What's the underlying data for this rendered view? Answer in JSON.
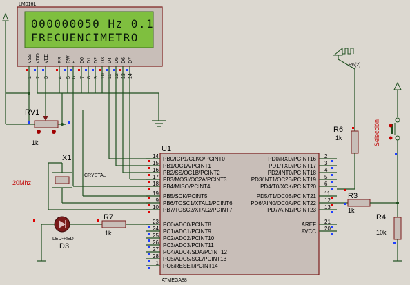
{
  "lcd": {
    "ref": "LM016L",
    "line1": "000000050 Hz 0.1",
    "line2": "FRECUENCIMETRO",
    "pins": [
      "VSS",
      "VDD",
      "VEE",
      "RS",
      "RW",
      "E",
      "D0",
      "D1",
      "D2",
      "D3",
      "D4",
      "D5",
      "D6",
      "D7"
    ],
    "pin_numbers": [
      "1",
      "2",
      "3",
      "4",
      "5",
      "6",
      "7",
      "8",
      "9",
      "10",
      "11",
      "12",
      "13",
      "14"
    ]
  },
  "rv1": {
    "ref": "RV1",
    "value": "1k"
  },
  "crystal": {
    "ref": "X1",
    "label": "CRYSTAL",
    "freq": "20Mhz"
  },
  "led": {
    "part": "LED-RED",
    "ref": "D3"
  },
  "r7": {
    "ref": "R7",
    "value": "1k"
  },
  "r6": {
    "ref": "R6",
    "value": "1k"
  },
  "r3": {
    "ref": "R3",
    "value": "1k"
  },
  "r4": {
    "ref": "R4",
    "value": "10k"
  },
  "u1": {
    "ref": "U1",
    "part": "ATMEGA88",
    "left_pins": [
      {
        "num": "14",
        "name": "PB0/ICP1/CLKO/PCINT0"
      },
      {
        "num": "15",
        "name": "PB1/OC1A/PCINT1"
      },
      {
        "num": "16",
        "name": "PB2/SS/OC1B/PCINT2"
      },
      {
        "num": "17",
        "name": "PB3/MOSI/OC2A/PCINT3"
      },
      {
        "num": "18",
        "name": "PB4/MISO/PCINT4"
      },
      {
        "num": "19",
        "name": "PB5/SCK/PCINT5"
      },
      {
        "num": "9",
        "name": "PB6/TOSC1/XTAL1/PCINT6"
      },
      {
        "num": "10",
        "name": "PB7/TOSC2/XTAL2/PCINT7"
      },
      {
        "num": "23",
        "name": "PC0/ADC0/PCINT8"
      },
      {
        "num": "24",
        "name": "PC1/ADC1/PCINT9"
      },
      {
        "num": "25",
        "name": "PC2/ADC2/PCINT10"
      },
      {
        "num": "26",
        "name": "PC3/ADC3/PCINT11"
      },
      {
        "num": "27",
        "name": "PC4/ADC4/SDA/PCINT12"
      },
      {
        "num": "28",
        "name": "PC5/ADC5/SCL/PCINT13"
      },
      {
        "num": "1",
        "name": "PC6/RESET/PCINT14"
      }
    ],
    "right_pins": [
      {
        "num": "2",
        "name": "PD0/RXD/PCINT16"
      },
      {
        "num": "3",
        "name": "PD1/TXD/PCINT17"
      },
      {
        "num": "4",
        "name": "PD2/INT0/PCINT18"
      },
      {
        "num": "5",
        "name": "PD3/INT1/OC2B/PCINT19"
      },
      {
        "num": "6",
        "name": "PD4/T0/XCK/PCINT20"
      },
      {
        "num": "11",
        "name": "PD5/T1/OC0B/PCINT21"
      },
      {
        "num": "12",
        "name": "PD6/AIN0/OC0A/PCINT22"
      },
      {
        "num": "13",
        "name": "PD7/AIN1/PCINT23"
      },
      {
        "num": "21",
        "name": "AREF"
      },
      {
        "num": "20",
        "name": "AVCC"
      }
    ]
  },
  "signal_gen": {
    "label": "R6(2)"
  },
  "switch": {
    "label": "Selección"
  },
  "colors": {
    "wire": "#1f4f1f",
    "body": "#c8beb8",
    "outline": "#7a1a1a",
    "lcd_screen": "#7fbf3f",
    "pin_red": "#e00000",
    "pin_blue": "#2040ff"
  }
}
